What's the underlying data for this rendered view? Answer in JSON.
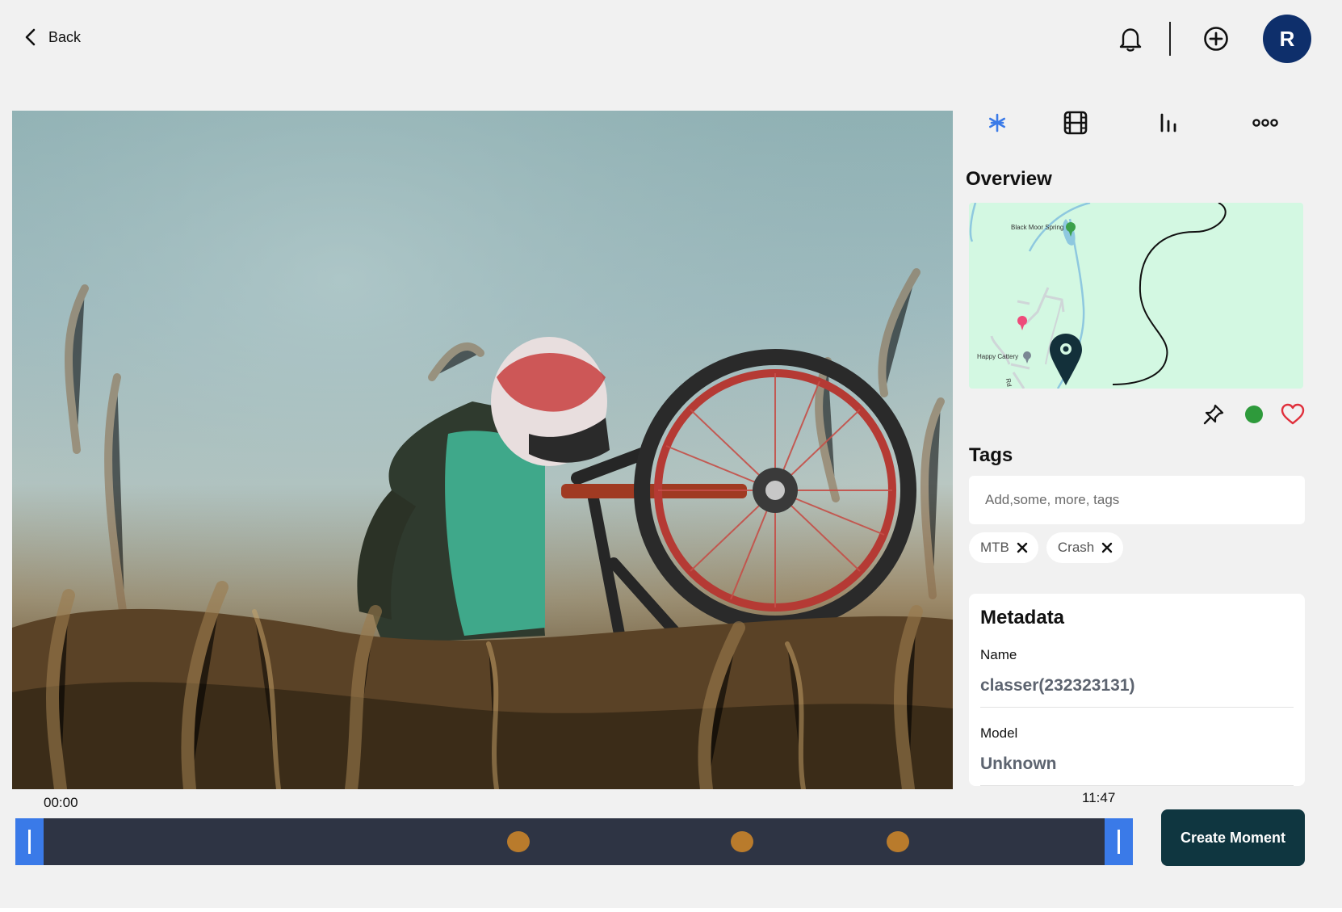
{
  "header": {
    "back_label": "Back",
    "avatar_initial": "R"
  },
  "video": {
    "time_start": "00:00",
    "time_end": "11:47",
    "markers_fraction": [
      0.45,
      0.65,
      0.79
    ]
  },
  "actions": {
    "create_moment_label": "Create Moment"
  },
  "tabs": [
    {
      "name": "overview-tab",
      "icon": "asterisk-icon",
      "active": true
    },
    {
      "name": "clips-tab",
      "icon": "film-icon",
      "active": false
    },
    {
      "name": "stats-tab",
      "icon": "bar-chart-icon",
      "active": false
    },
    {
      "name": "more-tab",
      "icon": "more-icon",
      "active": false
    }
  ],
  "overview": {
    "title": "Overview",
    "map": {
      "poi_1": "Black Moor Spring",
      "poi_2": "Happy Cattery",
      "road_label": "Rd"
    },
    "status_color": "#2e9a3b",
    "favorite_color": "#e0303c"
  },
  "tags": {
    "title": "Tags",
    "input_placeholder": "Add,some, more, tags",
    "items": [
      "MTB",
      "Crash"
    ]
  },
  "metadata": {
    "title": "Metadata",
    "fields": [
      {
        "label": "Name",
        "value": "classer(232323131)"
      },
      {
        "label": "Model",
        "value": "Unknown"
      }
    ]
  },
  "colors": {
    "accent_blue": "#3a7ae8",
    "avatar_bg": "#0e2f6b",
    "button_bg": "#0f3640",
    "timeline_bg": "#2e3444",
    "marker": "#b97b2c"
  }
}
